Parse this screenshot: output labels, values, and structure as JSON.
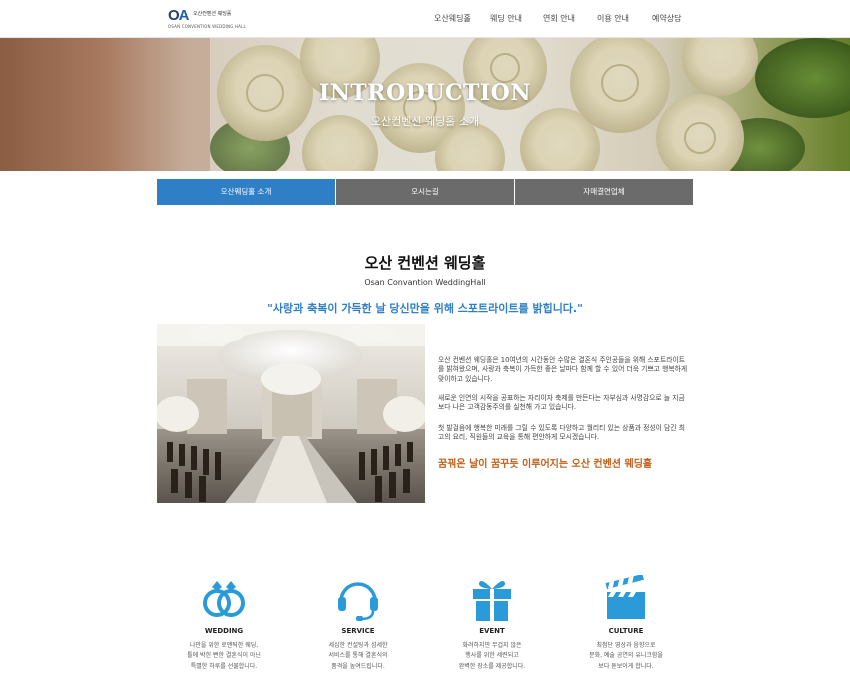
{
  "header": {
    "logo": {
      "mark_o": "O",
      "mark_a": "A",
      "kr": "오산컨벤션 웨딩홀",
      "en": "OSAN CONVENTION WEDDING HALL"
    },
    "nav": [
      "오산웨딩홀",
      "웨딩 안내",
      "연회 안내",
      "이용 안내",
      "예약상담"
    ]
  },
  "hero": {
    "title": "INTRODUCTION",
    "subtitle": "오산컨벤션 웨딩홀 소개"
  },
  "tabs": [
    {
      "label": "오산웨딩홀 소개",
      "active": true
    },
    {
      "label": "오시는길",
      "active": false
    },
    {
      "label": "자매결연업체",
      "active": false
    }
  ],
  "intro": {
    "title": "오산 컨벤션 웨딩홀",
    "subtitle_en": "Osan Convantion WeddingHall",
    "quote": "\"사랑과 축복이 가득한 날 당신만을 위해 스포트라이트를 밝힙니다.\"",
    "paragraphs": [
      "오산 컨벤션 웨딩홀은 10여년의 시간동안 수많은 결혼식 주인공들을 위해 스포트라이트를 밝혀왔으며, 사랑과 축복이 가득한 좋은 날마다 함께 할 수 있어 더욱 기쁘고 행복하게 맞이하고 있습니다.",
      "새로운 인연의 시작을 공표하는 자리이자 축제를 만든다는 자부심과 사명감으로 늘 지금보다 나은 고객감동주의를 실천해 가고 있습니다.",
      "첫 발걸음에 행복한 미래를 그릴 수 있도록 다양하고 퀄리티 있는 상품과 정성이 담긴 최고의 요리, 직원들의 교육을 통해 편안하게 모시겠습니다."
    ],
    "slogan": "꿈꿔온 날이 꿈꾸듯 이루어지는 오산 컨벤션 웨딩홀"
  },
  "features": [
    {
      "icon": "rings-icon",
      "title": "WEDDING",
      "lines": [
        "나만을 위한 로맨틱한 웨딩,",
        "틀에 박힌 뻔한 결혼식이 아닌",
        "특별한 하루를 선물합니다."
      ]
    },
    {
      "icon": "headset-icon",
      "title": "SERVICE",
      "lines": [
        "세심한 컨설팅과 섬세한",
        "서비스를 통해 결혼식의",
        "품격을 높여드립니다."
      ]
    },
    {
      "icon": "gift-icon",
      "title": "EVENT",
      "lines": [
        "화려하지만 무겁지 않은",
        "행사를 위한 세련되고",
        "완벽한 장소를 제공합니다."
      ]
    },
    {
      "icon": "clapperboard-icon",
      "title": "CULTURE",
      "lines": [
        "최첨단 영상과 음향으로",
        "문화, 예술 공연의 유니크함을",
        "보다 돋보이게 합니다."
      ]
    }
  ],
  "colors": {
    "accent": "#2f7fc6",
    "tab_inactive": "#6b6b6b",
    "slogan": "#c0601a",
    "icon": "#2b9ad8"
  }
}
